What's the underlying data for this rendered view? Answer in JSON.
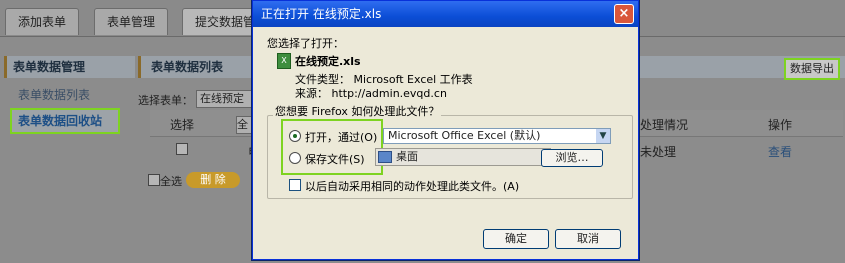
{
  "tabs": [
    "添加表单",
    "表单管理",
    "提交数据管"
  ],
  "sidebar": {
    "title": "表单数据管理",
    "items": [
      "表单数据列表",
      "表单数据回收站"
    ]
  },
  "main": {
    "title": "表单数据列表",
    "export_label": "数据导出",
    "filter_label": "选择表单：",
    "filter_value": "在线预定",
    "columns": {
      "select": "选择",
      "select_value": "全部",
      "handle": "处理情况",
      "ops": "操作"
    },
    "row": {
      "prefix": "电",
      "status": "未处理",
      "view": "查看"
    },
    "select_all": "全选",
    "delete_label": "删  除"
  },
  "dialog": {
    "title": "正在打开 在线预定.xls",
    "close": "×",
    "you_chose": "您选择了打开：",
    "filename": "在线预定.xls",
    "filetype": "文件类型： Microsoft Excel 工作表",
    "source": "来源： http://admin.evqd.cn",
    "question": "您想要 Firefox 如何处理此文件？",
    "open_with": "打开，通过(O)",
    "app": "Microsoft Office Excel (默认)",
    "save_file": "保存文件(S)",
    "desktop": "桌面",
    "browse": "浏览…",
    "remember": "以后自动采用相同的动作处理此类文件。(A)",
    "ok": "确定",
    "cancel": "取消"
  },
  "colors": {
    "highlight": "#7ed321",
    "titlebar": "#0b4ed6",
    "dialog_bg": "#ece9d8"
  }
}
